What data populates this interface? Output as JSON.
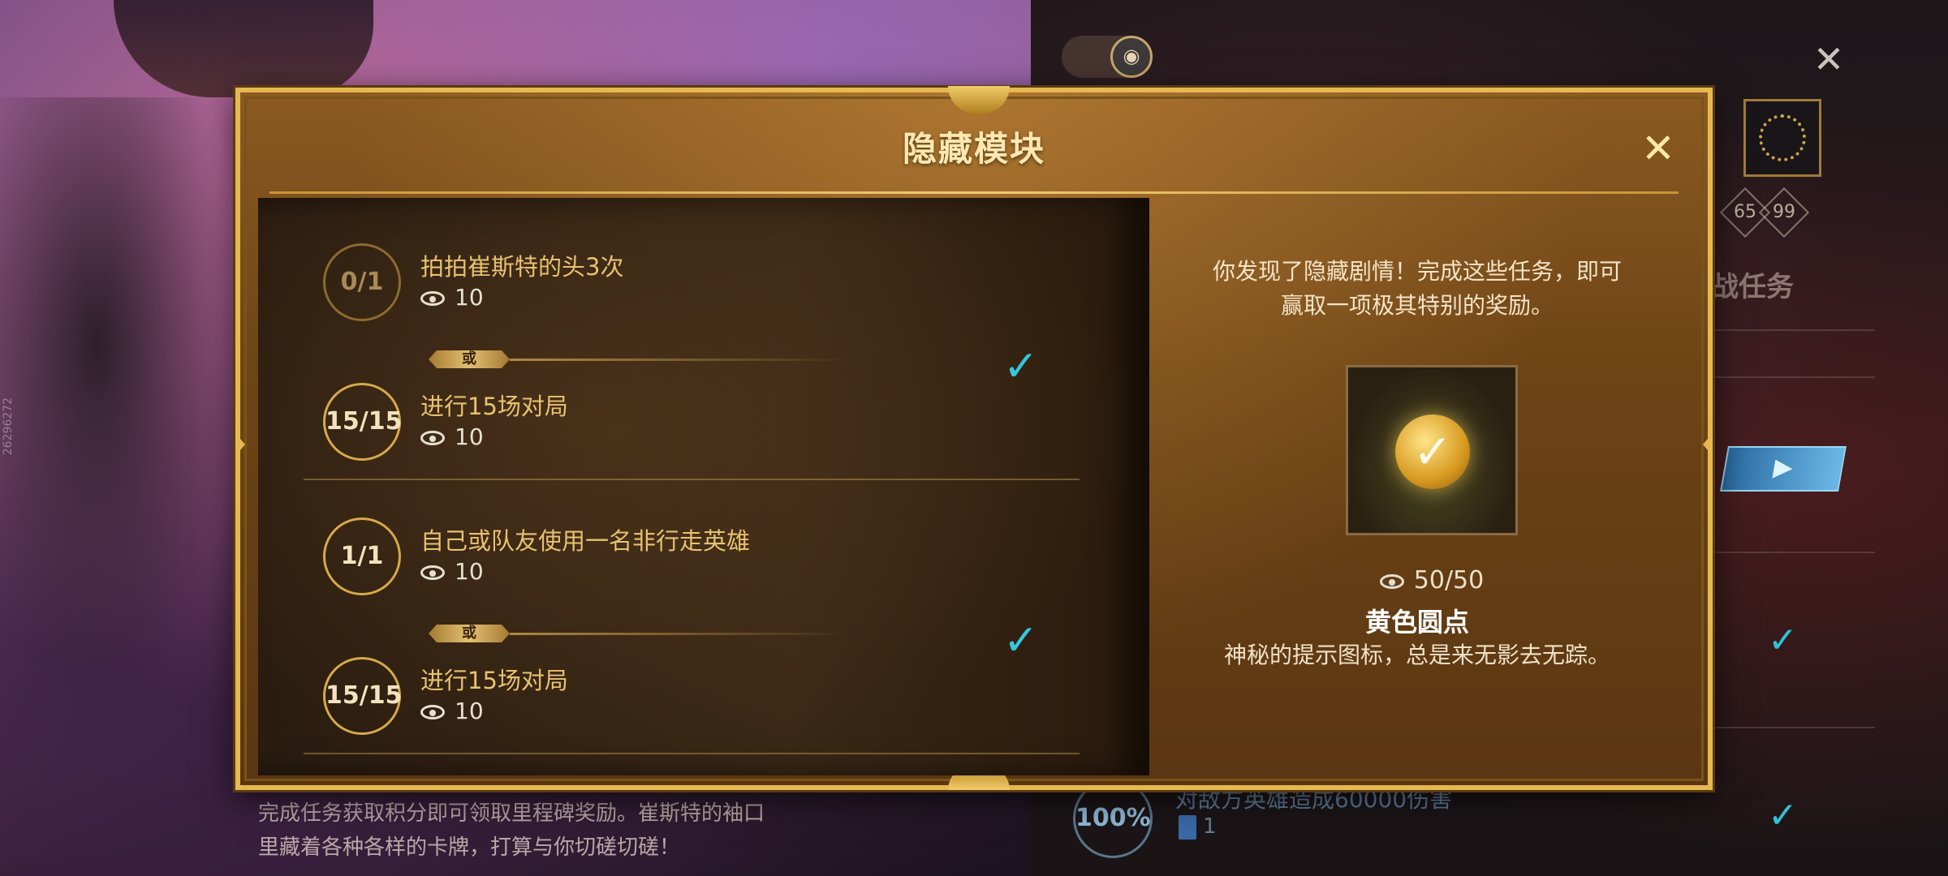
{
  "modal": {
    "title": "隐藏模块",
    "close_symbol": "✕"
  },
  "task_groups": [
    {
      "tasks": [
        {
          "badge": "0/1",
          "name": "拍拍崔斯特的头3次",
          "reward": "10",
          "done": false
        },
        {
          "badge": "15/15",
          "name": "进行15场对局",
          "reward": "10",
          "done": true
        }
      ],
      "or_label": "或",
      "completed": true
    },
    {
      "tasks": [
        {
          "badge": "1/1",
          "name": "自己或队友使用一名非行走英雄",
          "reward": "10",
          "done": true
        },
        {
          "badge": "15/15",
          "name": "进行15场对局",
          "reward": "10",
          "done": true
        }
      ],
      "or_label": "或",
      "completed": true
    }
  ],
  "reward": {
    "intro_line1": "你发现了隐藏剧情！完成这些任务，即可",
    "intro_line2": "赢取一项极其特别的奖励。",
    "progress": "50/50",
    "name": "黄色圆点",
    "description": "神秘的提示图标，总是来无影去无踪。"
  },
  "background": {
    "desc_line1": "完成任务获取积分即可领取里程碑奖励。崔斯特的袖口",
    "desc_line2": "里藏着各种各样的卡牌，打算与你切磋切磋！",
    "watermark": "26296272",
    "level_left": "65",
    "level_right": "99",
    "section_label": "战任务",
    "task_percent": "100%",
    "task_text": "对敌方英雄造成60000伤害",
    "task_count": "1",
    "close_symbol": "✕"
  },
  "colors": {
    "accent_gold": "#e6b850",
    "check_cyan": "#34c8e0",
    "task_text": "#e7c270"
  },
  "icons": {
    "eye": "eye-icon",
    "check": "checkmark-icon",
    "close": "close-icon"
  }
}
